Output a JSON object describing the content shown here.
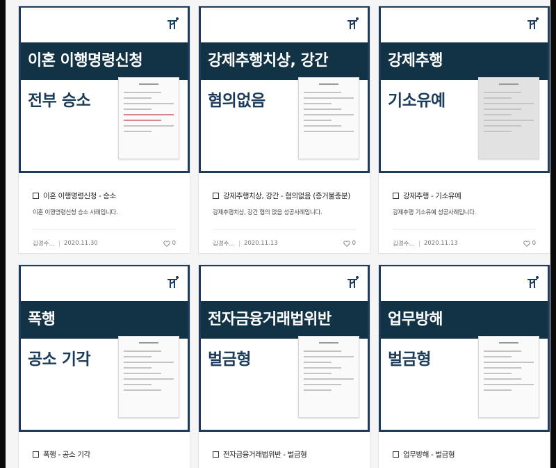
{
  "cards": [
    {
      "band": "이혼 이행명령신청",
      "result": "전부 승소",
      "title": "이혼 이행명령신청 - 승소",
      "desc": "이혼 이행명령신청 승소 사례입니다.",
      "author": "김경수…",
      "date": "2020.11.30",
      "likes": "0"
    },
    {
      "band": "강제추행치상, 강간",
      "result": "혐의없음",
      "title": "강제추행치상, 강간 - 혐의없음 (증거불충분)",
      "desc": "강제추행치상, 강간 혐의 없음 성공사례입니다.",
      "author": "김경수…",
      "date": "2020.11.13",
      "likes": "0"
    },
    {
      "band": "강제추행",
      "result": "기소유예",
      "title": "강제추행 - 기소유예",
      "desc": "강제추행 기소유예 성공사례입니다.",
      "author": "김경수…",
      "date": "2020.11.13",
      "likes": "0"
    },
    {
      "band": "폭행",
      "result": "공소 기각",
      "title": "폭행 - 공소 기각"
    },
    {
      "band": "전자금융거래법위반",
      "result": "벌금형",
      "title": "전자금융거래법위반 - 벌금형"
    },
    {
      "band": "업무방해",
      "result": "벌금형",
      "title": "업무방해 - 벌금형"
    }
  ],
  "icons": {
    "logo": "firm-logo-icon",
    "like": "heart-icon",
    "checkbox": "checkbox-icon"
  },
  "colors": {
    "band": "#123246",
    "border": "#1e3a5c",
    "result_text": "#1b3c5a"
  }
}
